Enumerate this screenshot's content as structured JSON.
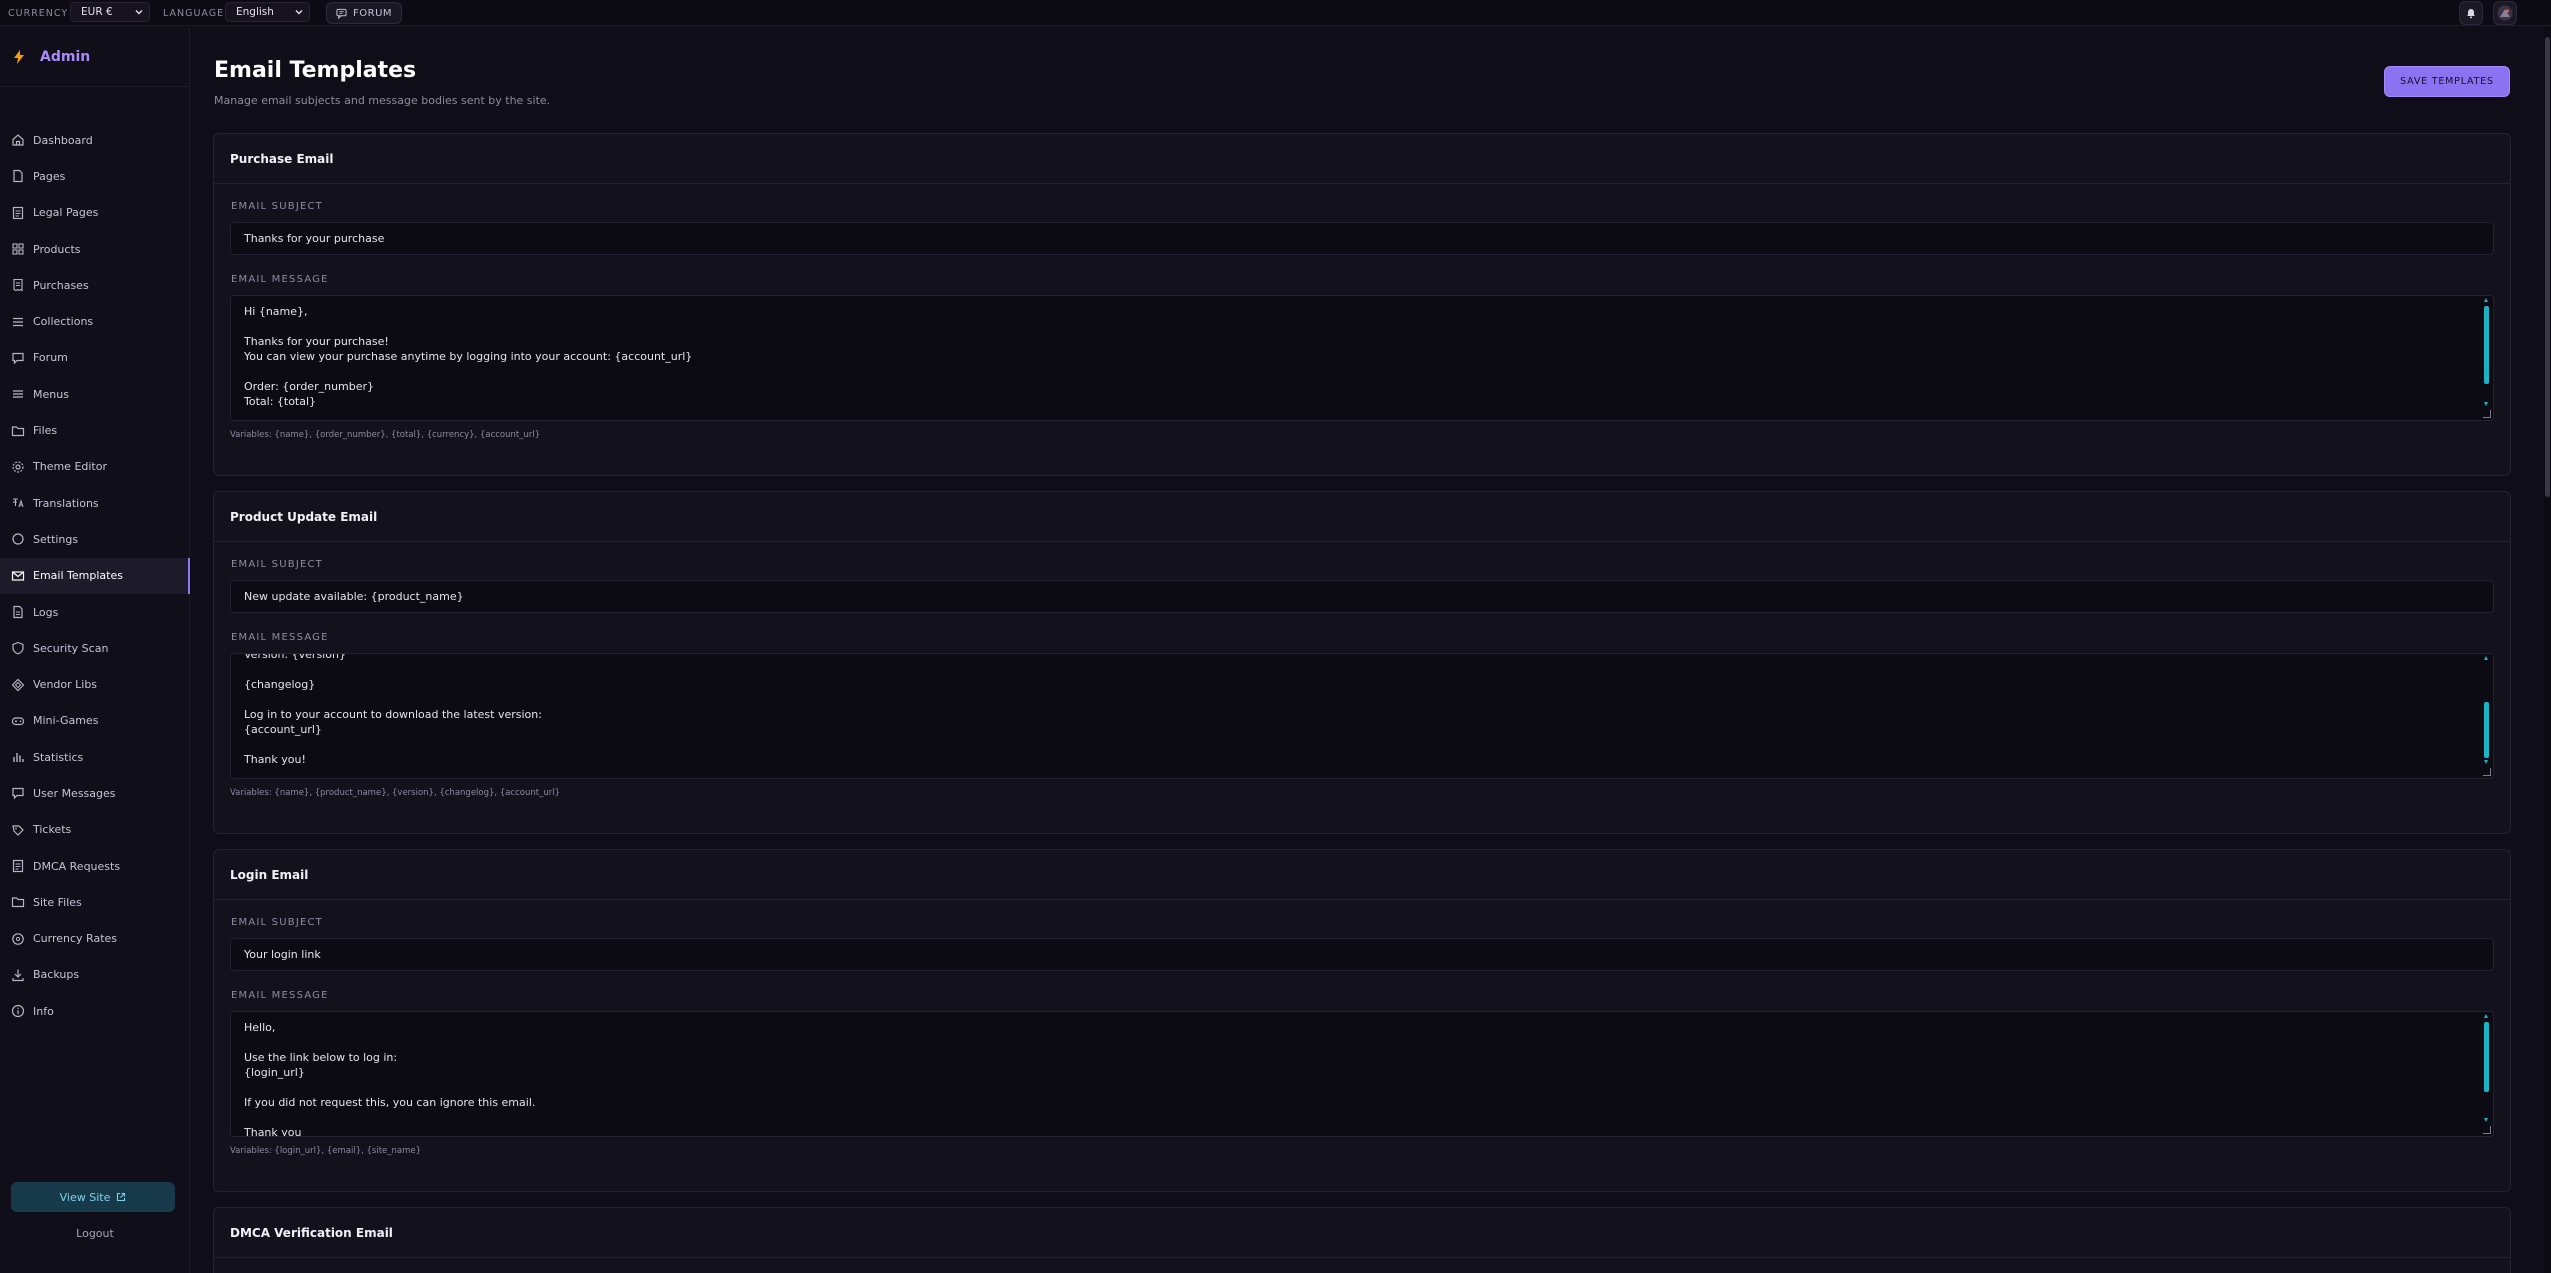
{
  "topbar": {
    "currency_label": "CURRENCY",
    "currency_value": "EUR €",
    "language_label": "LANGUAGE",
    "language_value": "English",
    "forum_label": "FORUM"
  },
  "brand": {
    "title": "Admin",
    "icon": "bolt-icon",
    "accent": "#a78bfa"
  },
  "sidebar": {
    "items": [
      {
        "label": "Dashboard",
        "icon": "home-icon"
      },
      {
        "label": "Pages",
        "icon": "file-icon"
      },
      {
        "label": "Legal Pages",
        "icon": "document-icon"
      },
      {
        "label": "Products",
        "icon": "grid-icon"
      },
      {
        "label": "Purchases",
        "icon": "receipt-icon"
      },
      {
        "label": "Collections",
        "icon": "list-icon"
      },
      {
        "label": "Forum",
        "icon": "chat-icon"
      },
      {
        "label": "Menus",
        "icon": "menu-icon"
      },
      {
        "label": "Files",
        "icon": "folder-icon"
      },
      {
        "label": "Theme Editor",
        "icon": "gear-icon"
      },
      {
        "label": "Translations",
        "icon": "translate-icon"
      },
      {
        "label": "Settings",
        "icon": "circle-icon"
      },
      {
        "label": "Email Templates",
        "icon": "mail-icon",
        "active": true
      },
      {
        "label": "Logs",
        "icon": "log-icon"
      },
      {
        "label": "Security Scan",
        "icon": "shield-icon"
      },
      {
        "label": "Vendor Libs",
        "icon": "diamond-icon"
      },
      {
        "label": "Mini-Games",
        "icon": "gamepad-icon"
      },
      {
        "label": "Statistics",
        "icon": "bar-chart-icon"
      },
      {
        "label": "User Messages",
        "icon": "message-icon"
      },
      {
        "label": "Tickets",
        "icon": "ticket-icon"
      },
      {
        "label": "DMCA Requests",
        "icon": "dmca-icon"
      },
      {
        "label": "Site Files",
        "icon": "site-files-icon"
      },
      {
        "label": "Currency Rates",
        "icon": "currency-icon"
      },
      {
        "label": "Backups",
        "icon": "download-icon"
      },
      {
        "label": "Info",
        "icon": "info-icon"
      }
    ],
    "view_site": "View Site",
    "logout": "Logout"
  },
  "main": {
    "title": "Email Templates",
    "subtitle": "Manage email subjects and message bodies sent by the site.",
    "save_label": "SAVE TEMPLATES",
    "subject_label": "EMAIL SUBJECT",
    "message_label": "EMAIL MESSAGE",
    "cards": [
      {
        "title": "Purchase Email",
        "subject": "Thanks for your purchase",
        "message": "Hi {name},\n\nThanks for your purchase!\nYou can view your purchase anytime by logging into your account: {account_url}\n\nOrder: {order_number}\nTotal: {total}",
        "variables": "Variables: {name}, {order_number}, {total}, {currency}, {account_url}"
      },
      {
        "title": "Product Update Email",
        "subject": "New update available: {product_name}",
        "message": "Version: {version}\n\n{changelog}\n\nLog in to your account to download the latest version:\n{account_url}\n\nThank you!",
        "variables": "Variables: {name}, {product_name}, {version}, {changelog}, {account_url}"
      },
      {
        "title": "Login Email",
        "subject": "Your login link",
        "message": "Hello,\n\nUse the link below to log in:\n{login_url}\n\nIf you did not request this, you can ignore this email.\n\nThank you",
        "variables": "Variables: {login_url}, {email}, {site_name}"
      },
      {
        "title": "DMCA Verification Email"
      }
    ]
  },
  "colors": {
    "background": "#0f0d17",
    "accent": "#8b72f0",
    "scrollbar": "#1ab3c3"
  }
}
